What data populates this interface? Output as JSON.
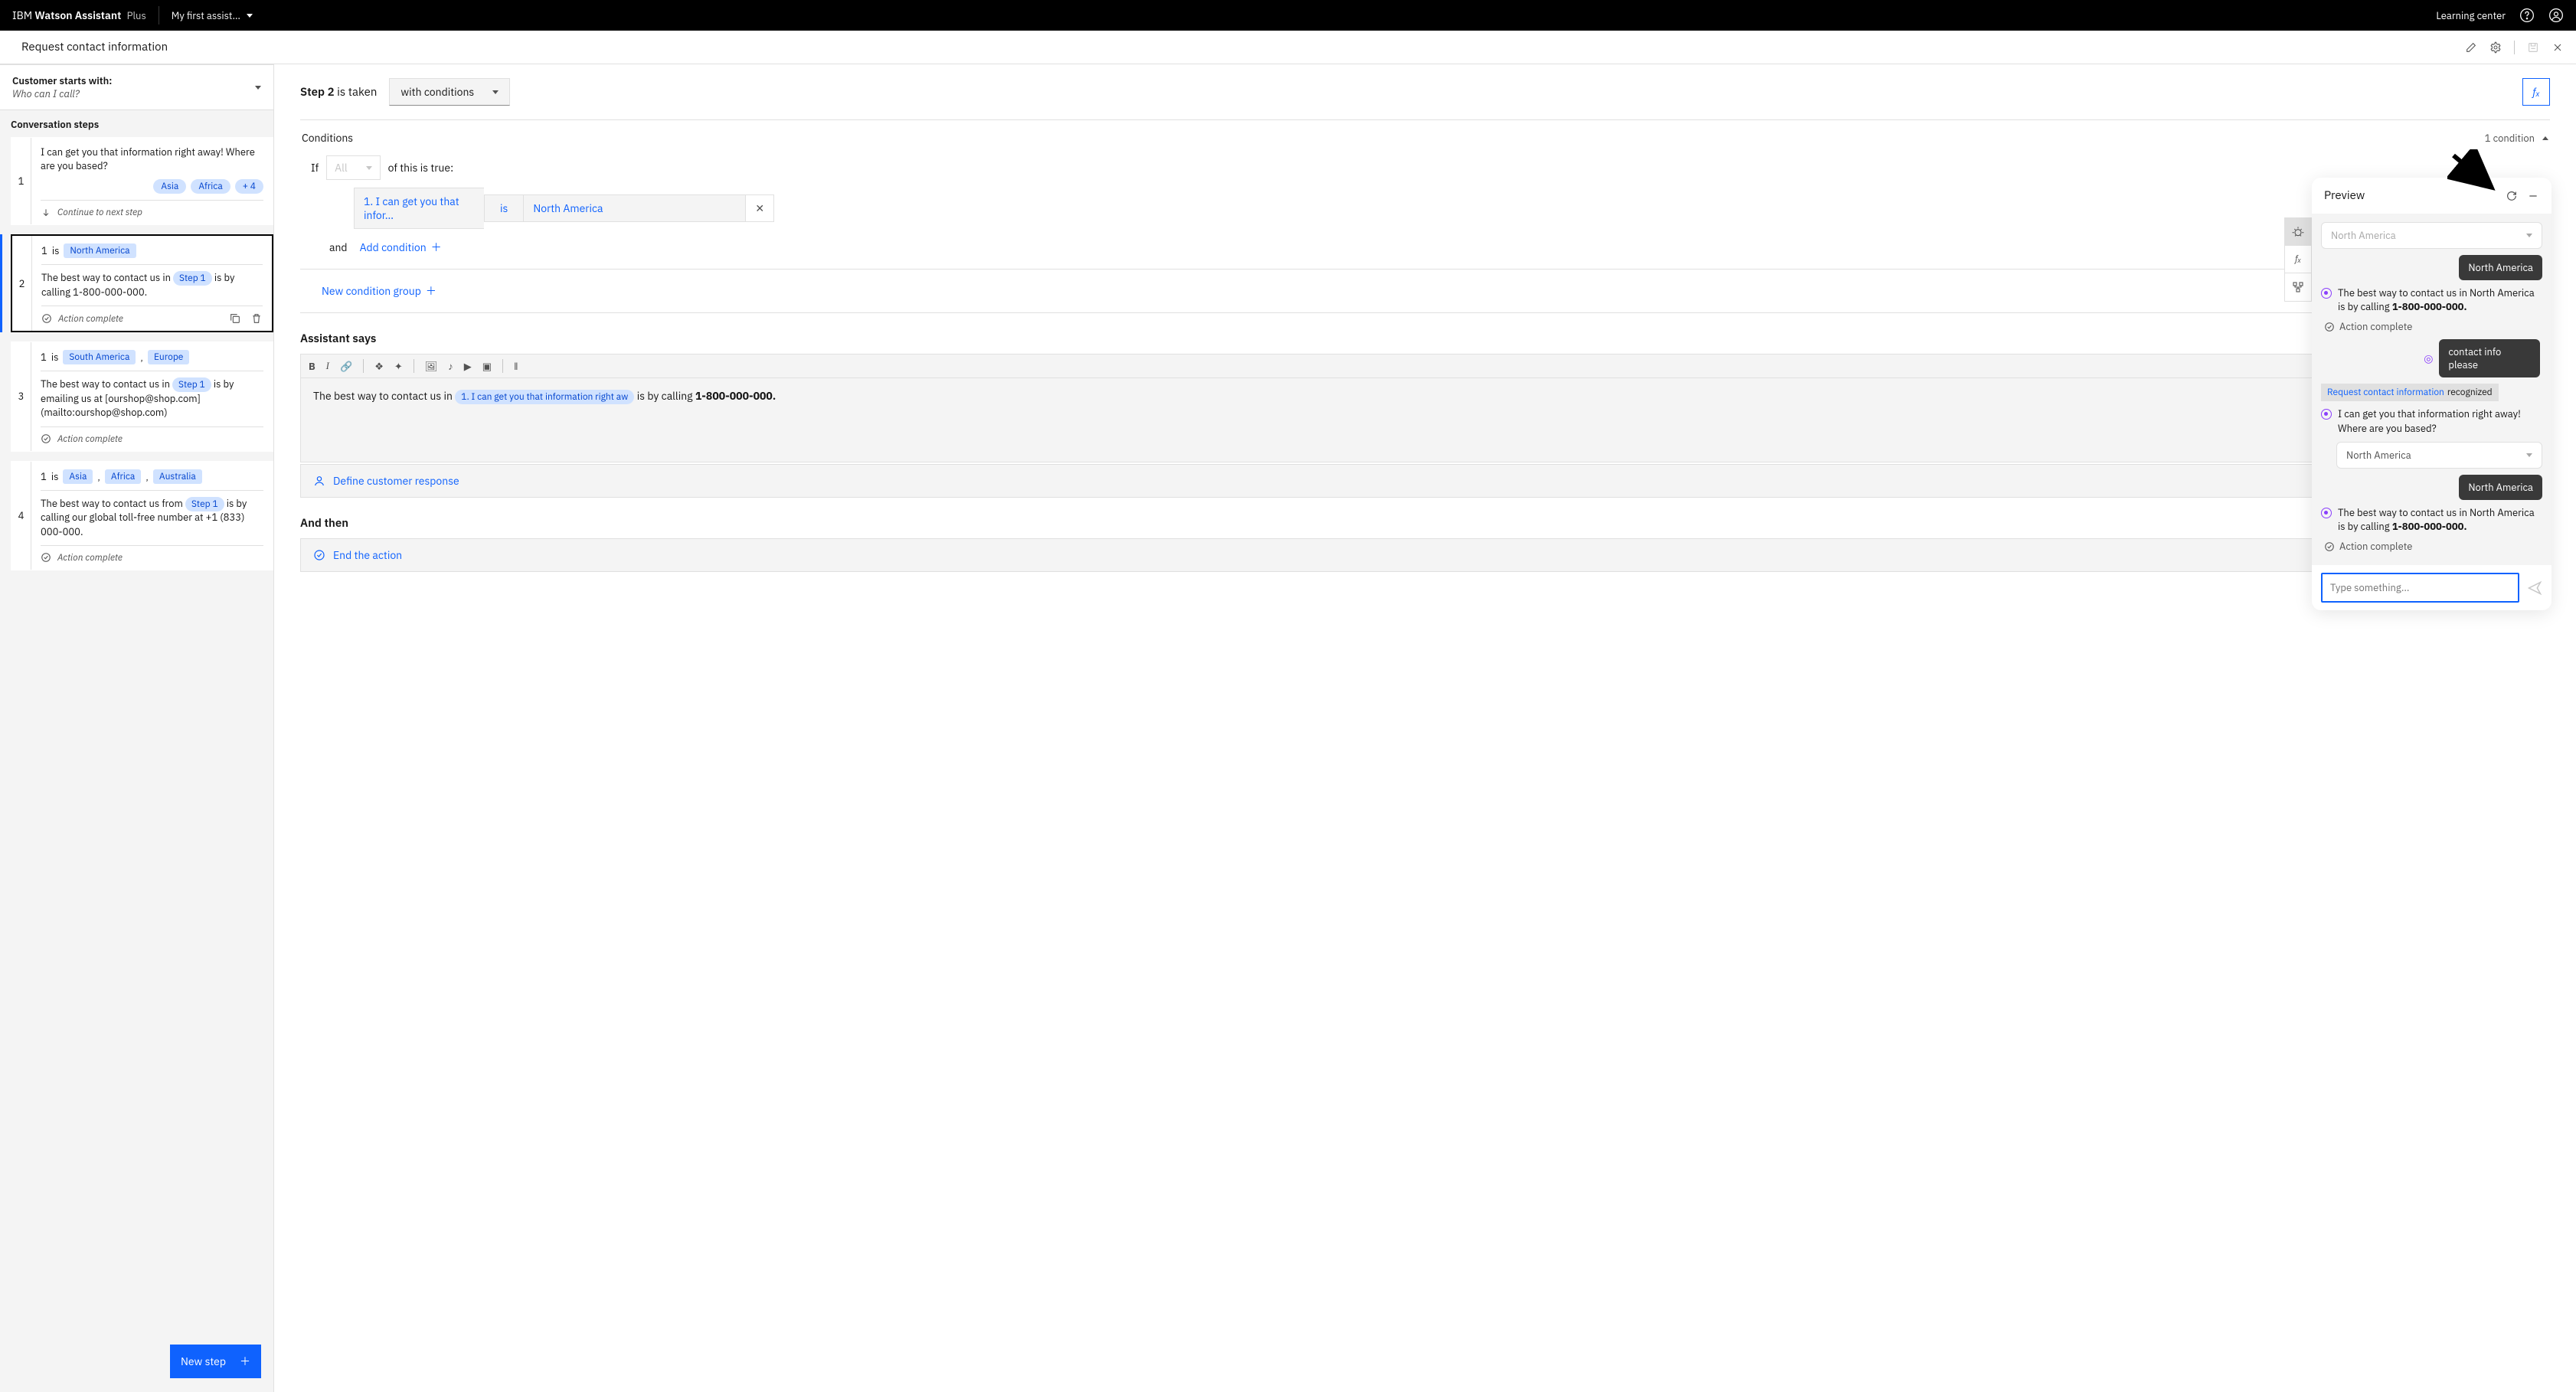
{
  "header": {
    "brand_prefix": "IBM ",
    "brand_main": "Watson Assistant",
    "plan": "Plus",
    "assistant_name": "My first assist…",
    "learning_center": "Learning center"
  },
  "subheader": {
    "title": "Request contact information"
  },
  "starts": {
    "label": "Customer starts with:",
    "value": "Who can I call?"
  },
  "steps_heading": "Conversation steps",
  "steps": [
    {
      "num": "1",
      "text": "I can get you that information right away! Where are you based?",
      "tags": [
        "Asia",
        "Africa",
        "+ 4"
      ],
      "continue": "Continue to next step"
    },
    {
      "num": "2",
      "cond_num": "1",
      "cond_is": "is",
      "cond_vals": [
        "North America"
      ],
      "text_pre": "The best way to contact us in ",
      "chip": "Step 1",
      "text_post": " is by calling 1-800-000-000.",
      "action_complete": "Action complete"
    },
    {
      "num": "3",
      "cond_num": "1",
      "cond_is": "is",
      "cond_vals": [
        "South America",
        "Europe"
      ],
      "text_pre": "The best way to contact us in ",
      "chip": "Step 1",
      "text_post": " is by emailing us at [ourshop@shop.com](mailto:ourshop@shop.com)",
      "action_complete": "Action complete"
    },
    {
      "num": "4",
      "cond_num": "1",
      "cond_is": "is",
      "cond_vals": [
        "Asia",
        "Africa",
        "Australia"
      ],
      "text_pre": "The best way to contact us from ",
      "chip": "Step 1",
      "text_post": " is by calling our global toll-free number at +1 (833) 000-000.",
      "action_complete": "Action complete"
    }
  ],
  "new_step": "New step",
  "editor": {
    "step_label_strong": "Step 2",
    "step_label_rest": " is taken",
    "taken_dropdown": "with conditions",
    "fx": "fₓ",
    "conditions_label": "Conditions",
    "condition_count": "1 condition",
    "if_label": "If",
    "all_label": "All",
    "of_true": "of this is true:",
    "cond_step_ref": "1. I can get you that infor…",
    "cond_op": "is",
    "cond_val": "North America",
    "and_label": "and",
    "add_condition": "Add condition",
    "new_group": "New condition group",
    "assistant_says": "Assistant says",
    "rt_text_pre": "The best way to contact us in ",
    "rt_chip": "1. I can get you that information right aw",
    "rt_text_mid": " is by calling ",
    "rt_text_bold": "1-800-000-000.",
    "define_response": "Define customer response",
    "and_then": "And then",
    "end_action": "End the action"
  },
  "preview": {
    "title": "Preview",
    "select_placeholder": "North America",
    "msgs": [
      {
        "type": "user",
        "text": "North America"
      },
      {
        "type": "asst",
        "text_pre": "The best way to contact us in North America is by calling ",
        "text_bold": "1-800-000-000."
      },
      {
        "type": "complete",
        "text": "Action complete"
      },
      {
        "type": "marker_user",
        "text": "contact info please"
      },
      {
        "type": "recognized",
        "action": "Request contact information",
        "label": " recognized"
      },
      {
        "type": "asst",
        "text_pre": "I can get you that information right away! Where are you based?",
        "text_bold": ""
      },
      {
        "type": "select",
        "value": "North America"
      },
      {
        "type": "user",
        "text": "North America"
      },
      {
        "type": "asst",
        "text_pre": "The best way to contact us in North America is by calling ",
        "text_bold": "1-800-000-000."
      },
      {
        "type": "complete",
        "text": "Action complete"
      }
    ],
    "input_placeholder": "Type something..."
  }
}
